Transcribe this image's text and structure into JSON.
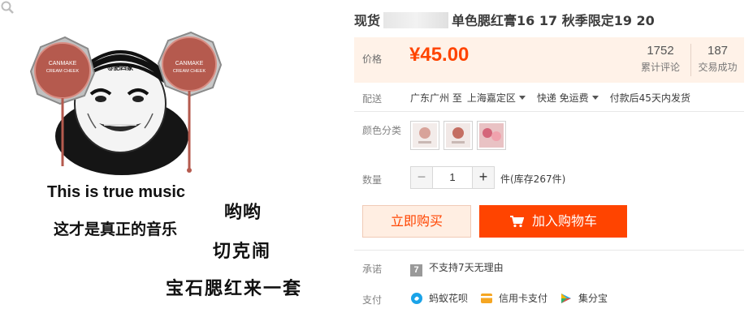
{
  "meme": {
    "headband_text": "@肥四家",
    "compact_text_line1": "CANMAKE",
    "compact_text_line2": "CREAM CHEEK",
    "caption_en": "This is true music",
    "caption_zh": "这才是真正的音乐",
    "shout_1": "哟哟",
    "shout_2": "切克闹",
    "shout_3": "宝石腮红来一套"
  },
  "product": {
    "title_prefix": "现货",
    "title_suffix": "单色腮红膏16 17 秋季限定19 20"
  },
  "price": {
    "label": "价格",
    "value": "¥45.00",
    "review_count": "1752",
    "review_label": "累计评论",
    "trade_count": "187",
    "trade_label": "交易成功"
  },
  "shipping": {
    "label": "配送",
    "from": "广东广州 至",
    "to": "上海嘉定区",
    "method": "快递 免运费",
    "dispatch": "付款后45天内发货"
  },
  "color": {
    "label": "颜色分类"
  },
  "quantity": {
    "label": "数量",
    "minus": "−",
    "value": "1",
    "plus": "+",
    "stock": "件(库存267件)"
  },
  "actions": {
    "buy_now": "立即购买",
    "add_to_cart": "加入购物车"
  },
  "promise": {
    "label": "承诺",
    "icon_text": "7",
    "text": "不支持7天无理由"
  },
  "payment": {
    "label": "支付",
    "method_1": "蚂蚁花呗",
    "method_2": "信用卡支付",
    "method_3": "集分宝"
  },
  "colors": {
    "accent": "#ff4400",
    "price_bg": "#fff2e8",
    "compact": "#b55a4e"
  }
}
